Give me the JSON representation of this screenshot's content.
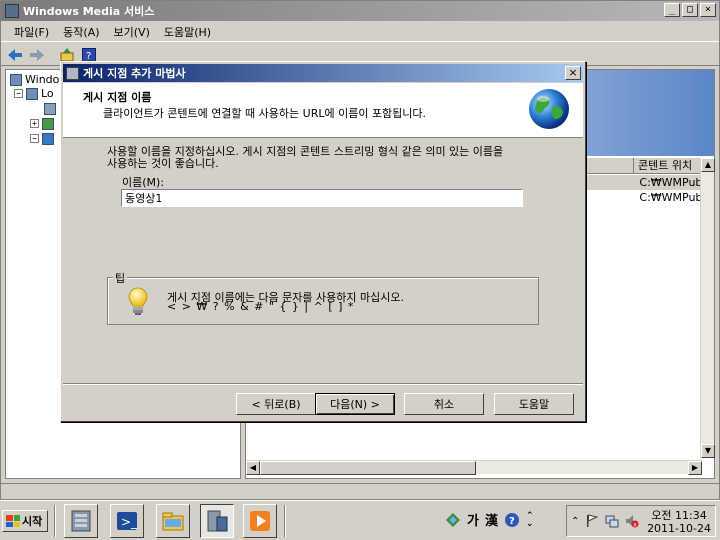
{
  "main_window": {
    "title": "Windows Media 서비스",
    "caption_buttons": [
      "_",
      "□",
      "×"
    ]
  },
  "menu": [
    "파일(F)",
    "동작(A)",
    "보기(V)",
    "도움말(H)"
  ],
  "toolbar_icons": [
    "back-icon",
    "forward-icon",
    "up-icon",
    "help-icon"
  ],
  "tree": {
    "items": [
      {
        "label": "Windo"
      },
      {
        "label": "Lo"
      }
    ]
  },
  "list": {
    "columns": [
      "콘텐트 위치"
    ],
    "rows": [
      {
        "location": "C:₩WMPub"
      },
      {
        "location": "C:₩WMPub"
      }
    ]
  },
  "dialog": {
    "title": "게시 지점 추가 마법사",
    "close": "×",
    "header_title": "게시 지점 이름",
    "header_subtitle": "클라이언트가 콘텐트에 연결할 때 사용하는 URL에 이름이 포함됩니다.",
    "description_line1": "사용할 이름을 지정하십시오. 게시 지점의 콘텐트 스트리밍 형식 같은 의미 있는 이름을",
    "description_line2": "사용하는 것이 좋습니다.",
    "name_label": "이름(M):",
    "name_value": "동영상1",
    "tip_legend": "팁",
    "tip_line1": "게시 지점 이름에는 다음 문자를 사용하지 마십시오.",
    "tip_line2": "< > ₩ ? % & # \" { } | ^ [ ] *",
    "buttons": {
      "back": "< 뒤로(B)",
      "next": "다음(N) >",
      "cancel": "취소",
      "help": "도움말"
    }
  },
  "taskbar": {
    "start_label": "시작",
    "lang_chars": [
      "가",
      "漢"
    ],
    "clock_line1": "오전 11:34",
    "clock_line2": "2011-10-24"
  }
}
